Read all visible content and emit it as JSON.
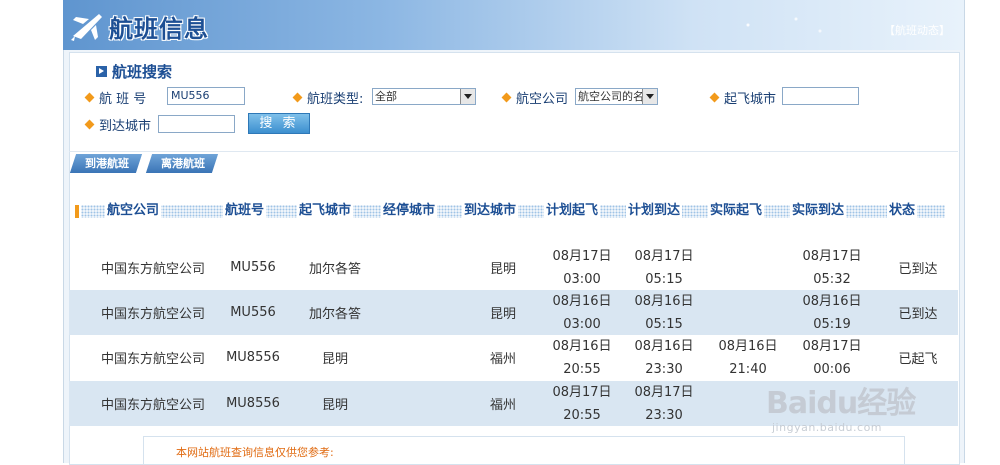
{
  "banner": {
    "title": "航班信息",
    "dynamic_label": "【航班动态】"
  },
  "search": {
    "title": "航班搜索",
    "flight_no_label": "航 班 号",
    "flight_no_value": "MU556",
    "flight_type_label": "航班类型:",
    "flight_type_value": "全部",
    "airline_label": "航空公司",
    "airline_value": "航空公司的名",
    "depart_city_label": "起飞城市",
    "depart_city_value": "",
    "arrive_city_label": "到达城市",
    "arrive_city_value": "",
    "search_button": "搜 索"
  },
  "tabs": [
    "到港航班",
    "离港航班"
  ],
  "table": {
    "headers": [
      "航空公司",
      "航班号",
      "起飞城市",
      "经停城市",
      "到达城市",
      "计划起飞",
      "计划到达",
      "实际起飞",
      "实际到达",
      "状态"
    ],
    "rows": [
      {
        "airline": "中国东方航空公司",
        "flight": "MU556",
        "from": "加尔各答",
        "via": "",
        "to": "昆明",
        "plan_dep": [
          "08月17日",
          "03:00"
        ],
        "plan_arr": [
          "08月17日",
          "05:15"
        ],
        "act_dep": [
          "",
          ""
        ],
        "act_arr": [
          "08月17日",
          "05:32"
        ],
        "status": "已到达"
      },
      {
        "airline": "中国东方航空公司",
        "flight": "MU556",
        "from": "加尔各答",
        "via": "",
        "to": "昆明",
        "plan_dep": [
          "08月16日",
          "03:00"
        ],
        "plan_arr": [
          "08月16日",
          "05:15"
        ],
        "act_dep": [
          "",
          ""
        ],
        "act_arr": [
          "08月16日",
          "05:19"
        ],
        "status": "已到达"
      },
      {
        "airline": "中国东方航空公司",
        "flight": "MU8556",
        "from": "昆明",
        "via": "",
        "to": "福州",
        "plan_dep": [
          "08月16日",
          "20:55"
        ],
        "plan_arr": [
          "08月16日",
          "23:30"
        ],
        "act_dep": [
          "08月16日",
          "21:40"
        ],
        "act_arr": [
          "08月17日",
          "00:06"
        ],
        "status": "已起飞"
      },
      {
        "airline": "中国东方航空公司",
        "flight": "MU8556",
        "from": "昆明",
        "via": "",
        "to": "福州",
        "plan_dep": [
          "08月17日",
          "20:55"
        ],
        "plan_arr": [
          "08月17日",
          "23:30"
        ],
        "act_dep": [
          "",
          ""
        ],
        "act_arr": [
          "",
          ""
        ],
        "status": ""
      }
    ]
  },
  "notice": "本网站航班查询信息仅供您参考:",
  "watermark": {
    "brand": "Baidu经验",
    "url": "jingyan.baidu.com"
  },
  "colors": {
    "accent": "#1d4f94",
    "orange": "#f29a1b",
    "row_alt": "#d9e6f2"
  }
}
